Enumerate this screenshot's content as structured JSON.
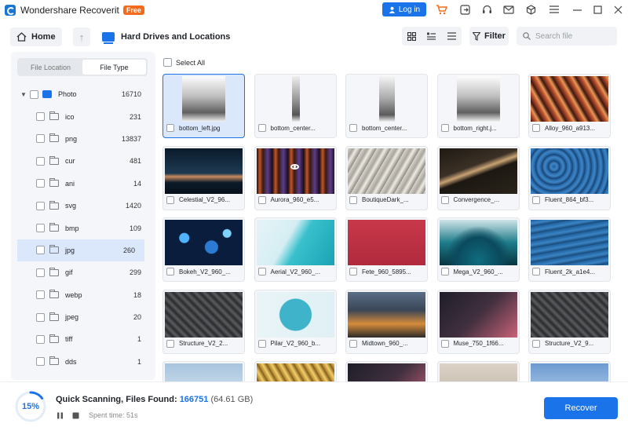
{
  "titlebar": {
    "app_name": "Wondershare Recoverit",
    "badge": "Free",
    "login_label": "Log in",
    "icons": [
      "cart-icon",
      "export-icon",
      "headset-icon",
      "mail-icon",
      "box-icon",
      "menu-icon",
      "minimize-icon",
      "maximize-icon",
      "close-icon"
    ]
  },
  "toolbar": {
    "home_label": "Home",
    "location_label": "Hard Drives and Locations",
    "filter_label": "Filter",
    "search_placeholder": "Search file"
  },
  "sidebar": {
    "tabs": [
      {
        "label": "File Location",
        "active": false
      },
      {
        "label": "File Type",
        "active": true
      }
    ],
    "root": {
      "label": "Photo",
      "count": "16710"
    },
    "items": [
      {
        "label": "ico",
        "count": "231"
      },
      {
        "label": "png",
        "count": "13837"
      },
      {
        "label": "cur",
        "count": "481"
      },
      {
        "label": "ani",
        "count": "14"
      },
      {
        "label": "svg",
        "count": "1420"
      },
      {
        "label": "bmp",
        "count": "109"
      },
      {
        "label": "jpg",
        "count": "260",
        "selected": true
      },
      {
        "label": "gif",
        "count": "299"
      },
      {
        "label": "webp",
        "count": "18"
      },
      {
        "label": "jpeg",
        "count": "20"
      },
      {
        "label": "tiff",
        "count": "1"
      },
      {
        "label": "dds",
        "count": "1"
      }
    ]
  },
  "main": {
    "select_all_label": "Select All",
    "files": [
      {
        "name": "bottom_left.jpg",
        "thumb": "gray-gradient",
        "selected": true
      },
      {
        "name": "bottom_center...",
        "thumb": "gray-strip"
      },
      {
        "name": "bottom_center...",
        "thumb": "gray-strip2"
      },
      {
        "name": "bottom_right.j...",
        "thumb": "gray-gradient"
      },
      {
        "name": "Alloy_960_a913...",
        "thumb": "alloy"
      },
      {
        "name": "Celestial_V2_96...",
        "thumb": "celestial"
      },
      {
        "name": "Aurora_960_e5...",
        "thumb": "aurora",
        "hover": true
      },
      {
        "name": "BoutiqueDark_...",
        "thumb": "boutique"
      },
      {
        "name": "Convergence_...",
        "thumb": "convergence"
      },
      {
        "name": "Fluent_864_bf3...",
        "thumb": "fluent"
      },
      {
        "name": "Bokeh_V2_960_...",
        "thumb": "bokeh"
      },
      {
        "name": "Aerial_V2_960_...",
        "thumb": "aerial"
      },
      {
        "name": "Fete_960_5895...",
        "thumb": "fete"
      },
      {
        "name": "Mega_V2_960_...",
        "thumb": "mega"
      },
      {
        "name": "Fluent_2k_a1e4...",
        "thumb": "fluent2"
      },
      {
        "name": "Structure_V2_2...",
        "thumb": "structure"
      },
      {
        "name": "Pilar_V2_960_b...",
        "thumb": "pilar"
      },
      {
        "name": "Midtown_960_...",
        "thumb": "midtown"
      },
      {
        "name": "Muse_750_1f66...",
        "thumb": "muse"
      },
      {
        "name": "Structure_V2_9...",
        "thumb": "structure"
      },
      {
        "name": "",
        "thumb": "sky"
      },
      {
        "name": "",
        "thumb": "gold"
      },
      {
        "name": "",
        "thumb": "muse"
      },
      {
        "name": "",
        "thumb": "sand"
      },
      {
        "name": "",
        "thumb": "blue"
      }
    ]
  },
  "footer": {
    "progress": 0.15,
    "progress_label": "15%",
    "scan_label": "Quick Scanning, Files Found:",
    "files_found": "166751",
    "size": "(64.61 GB)",
    "spent_label": "Spent time: 51s",
    "recover_label": "Recover"
  },
  "colors": {
    "accent": "#1a73e8",
    "badge": "#f26b1d"
  }
}
